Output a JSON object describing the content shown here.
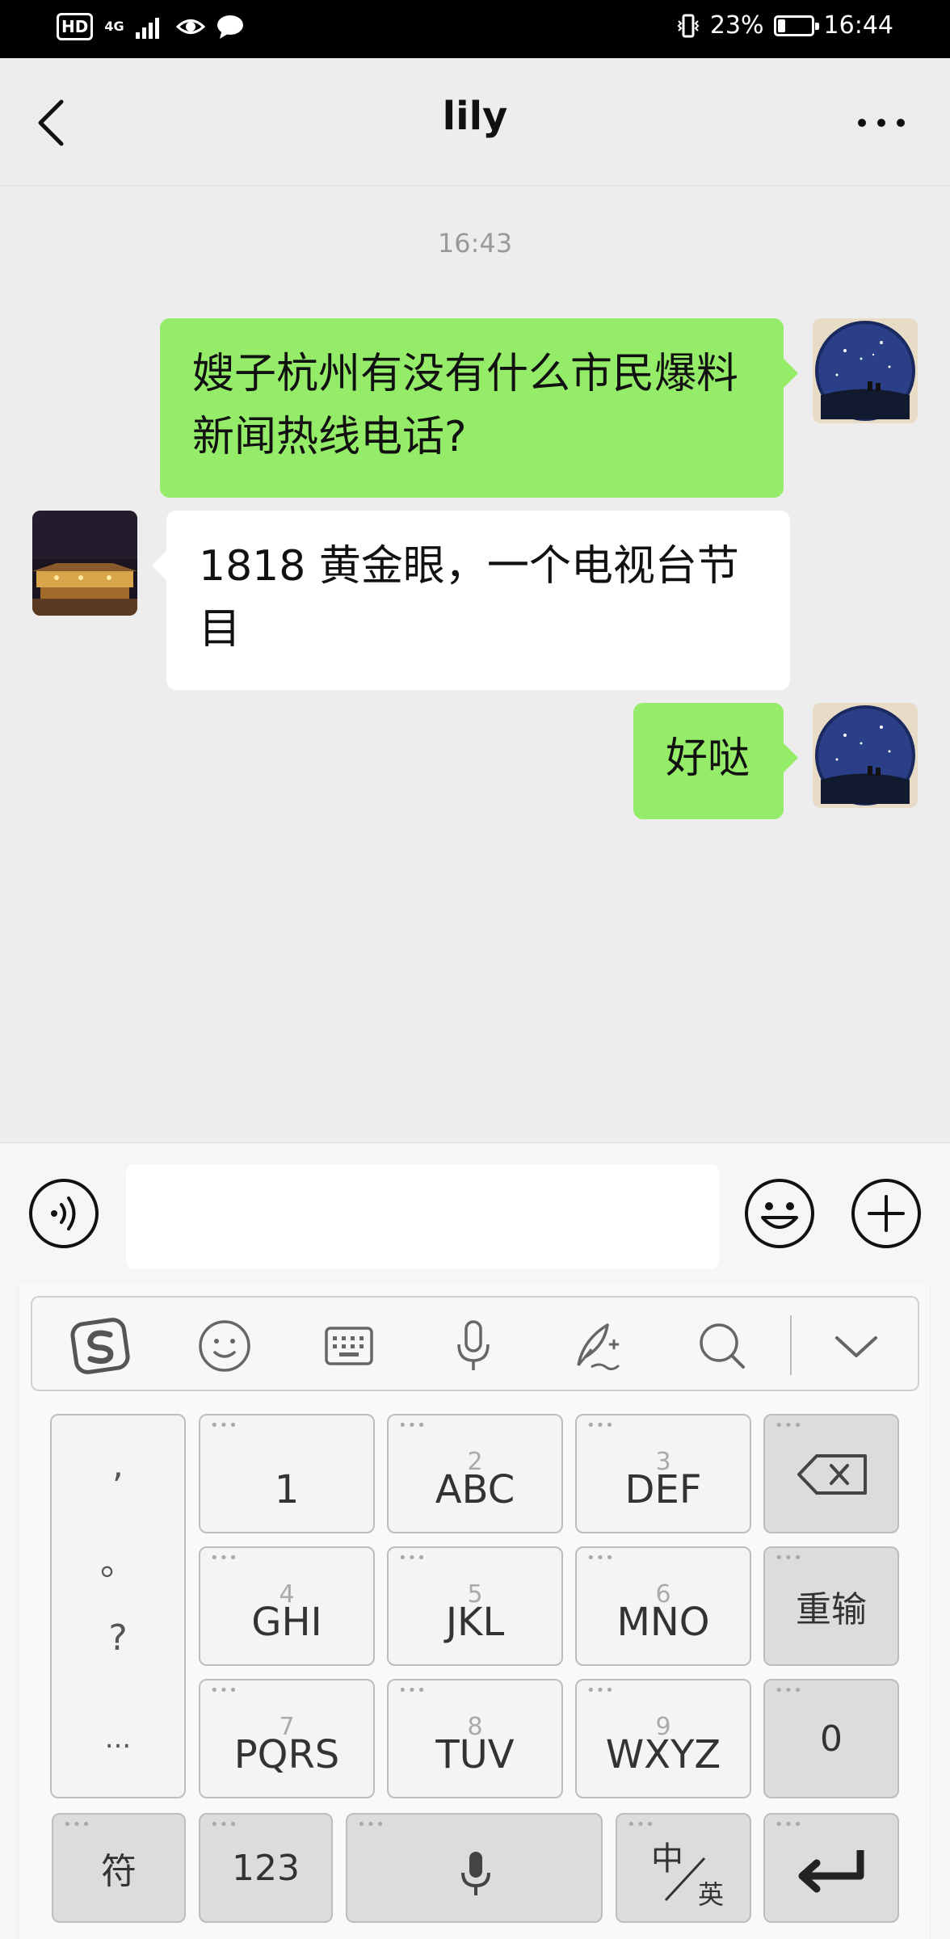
{
  "status_bar": {
    "hd": "HD",
    "network": "4G",
    "battery_percent": "23%",
    "battery_level": 0.23,
    "time": "16:44"
  },
  "header": {
    "title": "lily"
  },
  "chat": {
    "timestamp": "16:43",
    "messages": [
      {
        "side": "right",
        "text": "嫂子杭州有没有什么市民爆料新闻热线电话?"
      },
      {
        "side": "left",
        "text": "1818 黄金眼，一个电视台节目"
      },
      {
        "side": "right",
        "text": "好哒"
      }
    ]
  },
  "input": {
    "value": ""
  },
  "keyboard": {
    "punctuation": [
      ",",
      "。",
      "?",
      "..."
    ],
    "keys": [
      {
        "num": "",
        "label": "1"
      },
      {
        "num": "2",
        "label": "ABC"
      },
      {
        "num": "3",
        "label": "DEF"
      },
      {
        "num": "4",
        "label": "GHI"
      },
      {
        "num": "5",
        "label": "JKL"
      },
      {
        "num": "6",
        "label": "MNO"
      },
      {
        "num": "7",
        "label": "PQRS"
      },
      {
        "num": "8",
        "label": "TUV"
      },
      {
        "num": "9",
        "label": "WXYZ"
      }
    ],
    "retype": "重输",
    "zero": "0",
    "symbols": "符",
    "numbers": "123",
    "lang_zh": "中",
    "lang_en": "英"
  },
  "colors": {
    "sent_bubble": "#95ec69",
    "received_bubble": "#ffffff",
    "background": "#ededed"
  }
}
